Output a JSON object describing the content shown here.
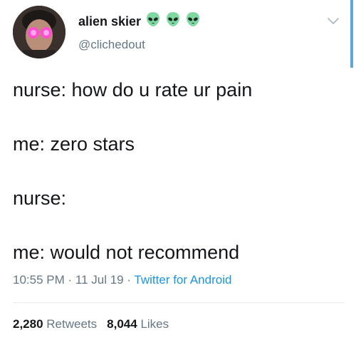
{
  "user": {
    "display_name": "alien skier",
    "handle": "@clichedout",
    "badge_icons": [
      "alien-icon",
      "alien-icon",
      "alien-icon"
    ]
  },
  "tweet": {
    "lines": [
      "nurse: how do u rate ur pain",
      "me: zero stars",
      "nurse:",
      "me: would not recommend"
    ]
  },
  "meta": {
    "time": "10:55 PM",
    "sep1": " · ",
    "date": "11 Jul 19",
    "sep2": " · ",
    "source": "Twitter for Android"
  },
  "stats": {
    "retweets_count": "2,280",
    "retweets_label": "Retweets",
    "likes_count": "8,044",
    "likes_label": "Likes"
  },
  "colors": {
    "text": "#14171a",
    "muted": "#657786",
    "link": "#1b95e0",
    "alien": "#7fd7a2"
  }
}
